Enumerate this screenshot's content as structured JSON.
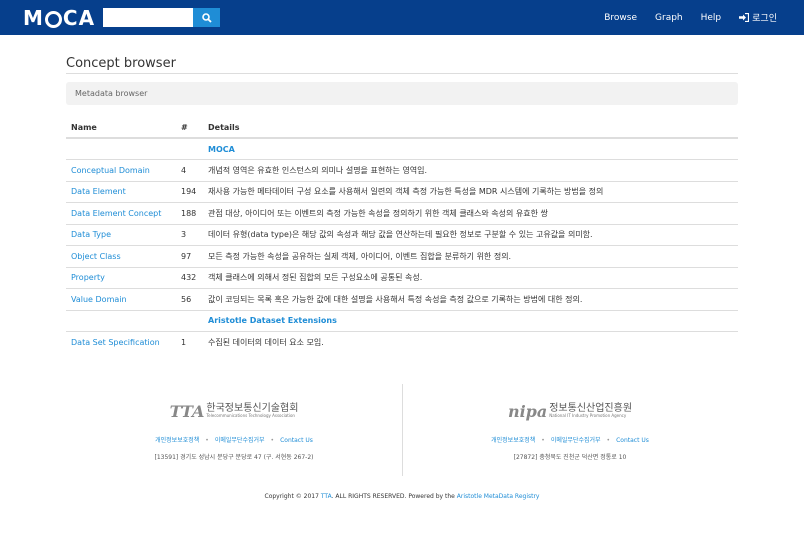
{
  "navbar": {
    "logo": {
      "pre": "M",
      "post": "CA"
    },
    "search": {
      "value": "",
      "placeholder": ""
    },
    "links": [
      {
        "label": "Browse"
      },
      {
        "label": "Graph"
      },
      {
        "label": "Help"
      },
      {
        "label": "로그인",
        "icon": "login-icon"
      }
    ],
    "colors": {
      "background": "#063f8c",
      "search_button": "#1f8dd6"
    }
  },
  "page": {
    "title": "Concept browser",
    "breadcrumb": "Metadata browser"
  },
  "table": {
    "headers": [
      "Name",
      "#",
      "Details"
    ],
    "sections": [
      {
        "title": "MOCA",
        "rows": [
          {
            "name": "Conceptual Domain",
            "count": "4",
            "details": "개념적 영역은 유효한 인스턴스의 의미나 설명을 표현하는 영역임."
          },
          {
            "name": "Data Element",
            "count": "194",
            "details": "재사용 가능한 메타데이터 구성 요소를 사용해서 일련의 객체 측정 가능한 특성을 MDR 시스템에 기록하는 방법을 정의"
          },
          {
            "name": "Data Element Concept",
            "count": "188",
            "details": "관점 대상, 아이디어 또는 이벤트의 측정 가능한 속성을 정의하기 위한 객체 클래스와 속성의 유효한 쌍"
          },
          {
            "name": "Data Type",
            "count": "3",
            "details": "데이터 유형(data type)은 해당 값의 속성과 해당 값을 연산하는데 필요한 정보로 구분할 수 있는 고유값을 의미함."
          },
          {
            "name": "Object Class",
            "count": "97",
            "details": "모든 측정 가능한 속성을 공유하는 실제 객체, 아이디어, 이벤트 집합을 분류하기 위한 정의."
          },
          {
            "name": "Property",
            "count": "432",
            "details": "객체 클래스에 의해서 정된 집합의 모든 구성요소에 공통된 속성."
          },
          {
            "name": "Value Domain",
            "count": "56",
            "details": "값이 코딩되는 목록 혹은 가능한 값에 대한 설명을 사용해서 특정 속성을 측정 값으로 기록하는 방법에 대한 정의."
          }
        ]
      },
      {
        "title": "Aristotle Dataset Extensions",
        "rows": [
          {
            "name": "Data Set Specification",
            "count": "1",
            "details": "수집된 데이터의 데이터 요소 모임."
          }
        ]
      }
    ]
  },
  "footer": {
    "left": {
      "logo_mark": "TTA",
      "org_name": "한국정보통신기술협회",
      "org_name_en": "Telecommunications Technology Association",
      "links": [
        "개인정보보호정책",
        "이메일무단수집거부",
        "Contact Us"
      ],
      "address": "[13591] 경기도 성남시 분당구 분당로 47 (구. 서현동 267-2)"
    },
    "right": {
      "logo_mark": "nipa",
      "org_name": "정보통신산업진흥원",
      "org_name_en": "National IT Industry Promotion Agency",
      "links": [
        "개인정보보호정책",
        "이메일무단수집거부",
        "Contact Us"
      ],
      "address": "[27872] 충청북도 진천군 덕산면 정통로 10"
    },
    "copyright": {
      "prefix": "Copyright © 2017",
      "tta_link": "TTA",
      "middle": ". ALL RIGHTS RESERVED. Powered by the",
      "registry_link": "Aristotle MetaData Registry"
    }
  }
}
